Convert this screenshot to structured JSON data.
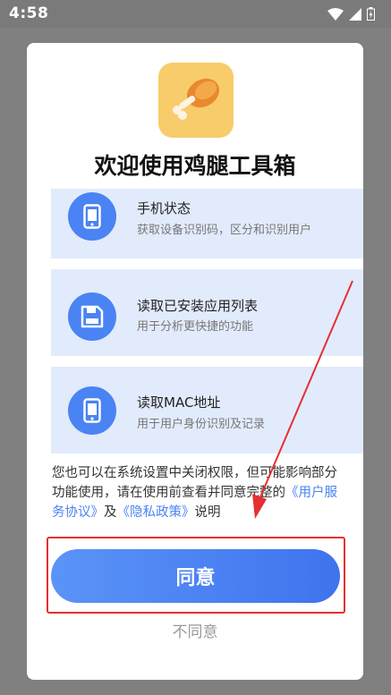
{
  "status_bar": {
    "time": "4:58"
  },
  "dialog": {
    "title": "欢迎使用鸡腿工具箱",
    "permissions": [
      {
        "name": "手机状态",
        "desc": "获取设备识别码，区分和识别用户",
        "icon": "phone-icon"
      },
      {
        "name": "读取已安装应用列表",
        "desc": "用于分析更快捷的功能",
        "icon": "floppy-icon"
      },
      {
        "name": "读取MAC地址",
        "desc": "用于用户身份识别及记录",
        "icon": "phone-icon"
      }
    ],
    "notice": {
      "text_1": "您也可以在系统设置中关闭权限，但可能影响部分功能使用，请在使用前查看并同意完整的",
      "link_terms": "《用户服务协议》",
      "text_2": "及",
      "link_privacy": "《隐私政策》",
      "text_3": "说明"
    },
    "agree_label": "同意",
    "disagree_label": "不同意"
  },
  "colors": {
    "accent": "#4a83f4",
    "highlight": "#e43030",
    "logo_bg": "#f8cc6a"
  }
}
